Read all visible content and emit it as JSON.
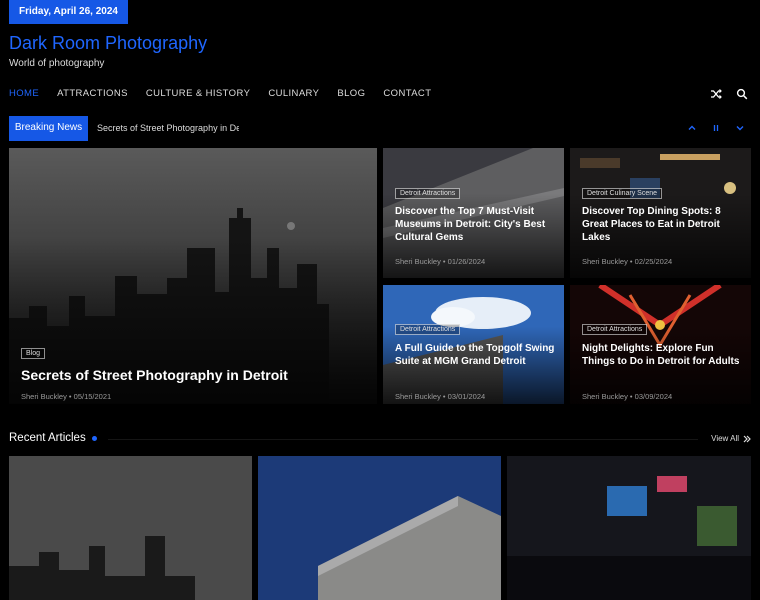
{
  "header": {
    "date": "Friday, April 26, 2024",
    "site_title": "Dark Room Photography",
    "tagline": "World of photography"
  },
  "nav": {
    "items": [
      "HOME",
      "ATTRACTIONS",
      "CULTURE & HISTORY",
      "CULINARY",
      "BLOG",
      "CONTACT"
    ],
    "active": "HOME",
    "icons": [
      "shuffle-icon",
      "search-icon"
    ]
  },
  "breaking": {
    "label": "Breaking News",
    "text": "Secrets of Street Photography in De",
    "controls": [
      "chevron-up-icon",
      "pause-icon",
      "chevron-down-icon"
    ]
  },
  "featured": {
    "main": {
      "category": "Blog",
      "title": "Secrets of Street Photography in Detroit",
      "meta": "Sheri Buckley • 05/15/2021"
    },
    "grid": [
      {
        "category": "Detroit Attractions",
        "title": "Discover the Top 7 Must-Visit Museums in Detroit: City's Best Cultural Gems",
        "meta": "Sheri Buckley • 01/26/2024"
      },
      {
        "category": "Detroit Culinary Scene",
        "title": "Discover Top Dining Spots: 8 Great Places to Eat in Detroit Lakes",
        "meta": "Sheri Buckley • 02/25/2024"
      },
      {
        "category": "Detroit Attractions",
        "title": "A Full Guide to the Topgolf Swing Suite at MGM Grand Detroit",
        "meta": "Sheri Buckley • 03/01/2024"
      },
      {
        "category": "Detroit Attractions",
        "title": "Night Delights: Explore Fun Things to Do in Detroit for Adults",
        "meta": "Sheri Buckley • 03/09/2024"
      }
    ]
  },
  "recent": {
    "title": "Recent Articles",
    "view_all": "View All"
  },
  "colors": {
    "accent": "#1658e6",
    "link": "#1f66ff"
  }
}
